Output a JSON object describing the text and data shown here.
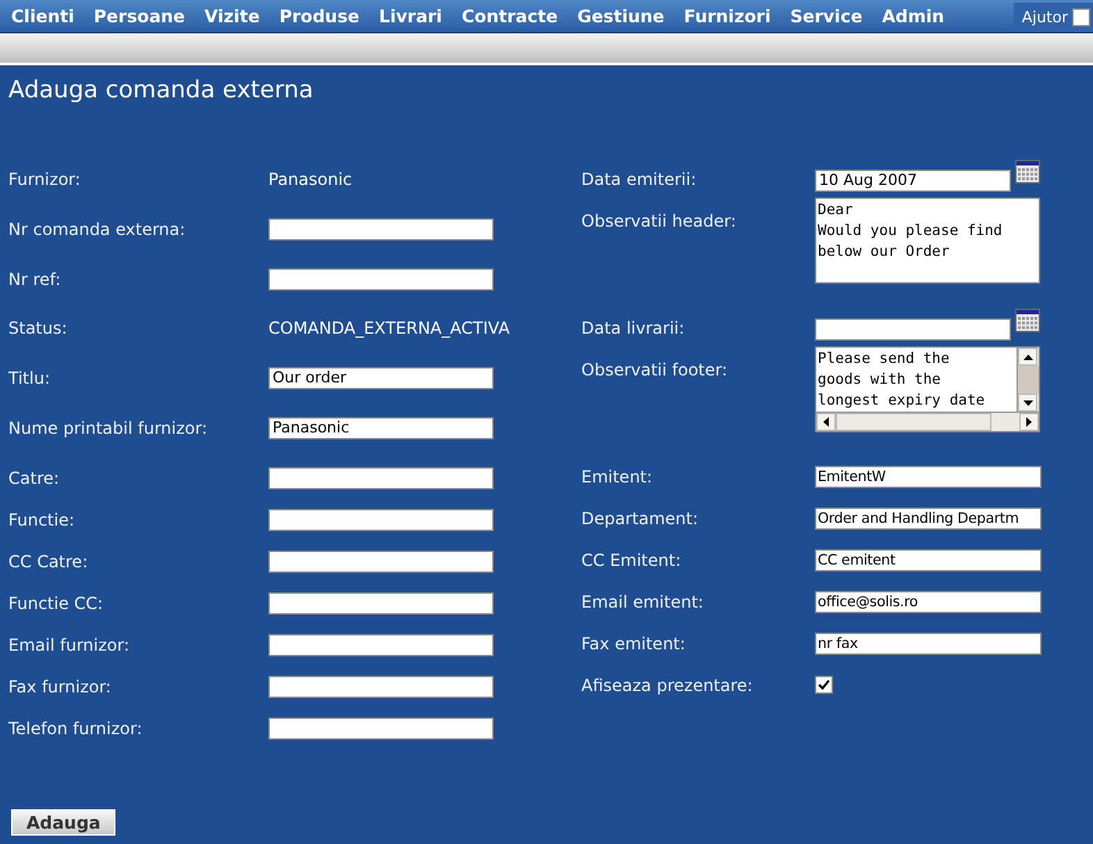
{
  "menu": [
    {
      "label": "Clienti"
    },
    {
      "label": "Persoane"
    },
    {
      "label": "Vizite"
    },
    {
      "label": "Produse"
    },
    {
      "label": "Livrari"
    },
    {
      "label": "Contracte"
    },
    {
      "label": "Gestiune"
    },
    {
      "label": "Furnizori"
    },
    {
      "label": "Service"
    },
    {
      "label": "Admin"
    }
  ],
  "help": {
    "label": "Ajutor",
    "checked": false
  },
  "title": "Adauga comanda externa",
  "left_fields": [
    {
      "label": "Furnizor:",
      "kind": "text",
      "value": "Panasonic"
    },
    {
      "label": "Nr comanda externa:",
      "kind": "input"
    },
    {
      "label": "Nr ref:",
      "kind": "input"
    },
    {
      "label": "Status:",
      "kind": "text",
      "value": "COMANDA_EXTERNA_ACTIVA"
    },
    {
      "label": "Titlu:",
      "kind": "input",
      "value": "Our order"
    },
    {
      "label": "Nume printabil furnizor:",
      "kind": "input",
      "value": "Panasonic"
    },
    {
      "label": "Catre:",
      "kind": "input"
    },
    {
      "label": "Functie:",
      "kind": "input"
    },
    {
      "label": "CC Catre:",
      "kind": "input"
    },
    {
      "label": "Functie CC:",
      "kind": "input"
    },
    {
      "label": "Email furnizor:",
      "kind": "input"
    },
    {
      "label": "Fax furnizor:",
      "kind": "input"
    },
    {
      "label": "Telefon furnizor:",
      "kind": "input"
    }
  ],
  "right_fields": [
    {
      "label": "Data emiterii:",
      "kind": "date",
      "value": "10 Aug 2007"
    },
    {
      "label": "Observatii header:",
      "kind": "textarea",
      "value": "Dear\nWould you please find\nbelow our Order",
      "scrollable": false
    },
    {
      "label": "Data livrarii:",
      "kind": "date"
    },
    {
      "label": "Observatii footer:",
      "kind": "textarea",
      "value": "Please send the\ngoods with the\nlongest expiry date",
      "scrollable": true
    },
    {
      "label": "Emitent:",
      "kind": "input",
      "value": "EmitentW"
    },
    {
      "label": "Departament:",
      "kind": "input",
      "value": "Order and Handling Departm"
    },
    {
      "label": "CC Emitent:",
      "kind": "input",
      "value": "CC emitent"
    },
    {
      "label": "Email emitent:",
      "kind": "input",
      "value": "office@solis.ro"
    },
    {
      "label": "Fax emitent:",
      "kind": "input",
      "value": "nr fax"
    },
    {
      "label": "Afiseaza prezentare:",
      "kind": "checkbox",
      "checked": true
    }
  ],
  "submit": "Adauga"
}
